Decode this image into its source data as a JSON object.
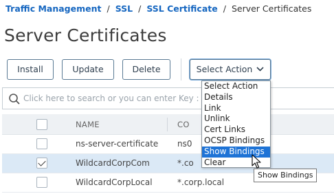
{
  "breadcrumb": {
    "items": [
      "Traffic Management",
      "SSL",
      "SSL Certificate"
    ],
    "separator": "/",
    "current": "Server Certificates"
  },
  "page": {
    "title": "Server Certificates"
  },
  "toolbar": {
    "install_label": "Install",
    "update_label": "Update",
    "delete_label": "Delete",
    "select_action_label": "Select Action"
  },
  "search": {
    "placeholder": "Click here to search or you can enter Key : Value"
  },
  "table": {
    "columns": [
      "NAME",
      "CO"
    ],
    "rows": [
      {
        "name": "ns-server-certificate",
        "common": "ns0",
        "selected": false
      },
      {
        "name": "WildcardCorpCom",
        "common": "*.co",
        "selected": true
      },
      {
        "name": "WildcardCorpLocal",
        "common": "*.corp.local",
        "selected": false
      }
    ]
  },
  "dropdown": {
    "items": [
      "Select Action",
      "Details",
      "Link",
      "Unlink",
      "Cert Links",
      "OCSP Bindings",
      "Show Bindings",
      "Clear"
    ],
    "highlighted": "Show Bindings"
  },
  "tooltip": "Show Bindings",
  "colors": {
    "link": "#1566c0",
    "highlight": "#1e73d6",
    "selected_row": "#dbe9f6"
  },
  "icons": {
    "search": "search-icon",
    "chevron": "chevron-down-icon",
    "cursor": "mouse-pointer-icon"
  }
}
